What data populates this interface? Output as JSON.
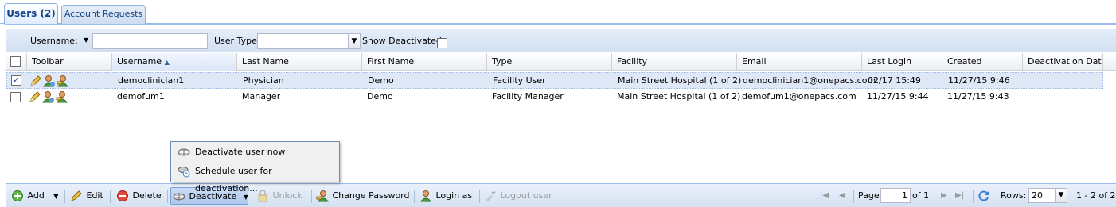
{
  "tabs": [
    {
      "label": "Users (2)"
    },
    {
      "label": "Account Requests"
    }
  ],
  "filter": {
    "username_label": "Username:",
    "username_value": "",
    "usertype_label": "User Type:",
    "usertype_value": "",
    "show_deactivated_label": "Show Deactivated:",
    "show_deactivated": false
  },
  "columns": [
    "Toolbar",
    "Username",
    "Last Name",
    "First Name",
    "Type",
    "Facility",
    "Email",
    "Last Login",
    "Created",
    "Deactivation Date"
  ],
  "sort": {
    "column": "Username",
    "direction": "ascending"
  },
  "rows": [
    {
      "selected": true,
      "username": "democlinician1",
      "last_name": "Physician",
      "first_name": "Demo",
      "type": "Facility User",
      "facility": "Main Street Hospital (1 of 2)",
      "email": "democlinician1@onepacs.com",
      "last_login": "02/17 15:49",
      "created": "11/27/15 9:46",
      "deactivation_date": ""
    },
    {
      "selected": false,
      "username": "demofum1",
      "last_name": "Manager",
      "first_name": "Demo",
      "type": "Facility Manager",
      "facility": "Main Street Hospital (1 of 2)",
      "email": "demofum1@onepacs.com",
      "last_login": "11/27/15 9:44",
      "created": "11/27/15 9:43",
      "deactivation_date": ""
    }
  ],
  "row_icons": [
    "pencil-icon",
    "user-icon",
    "key-user-icon"
  ],
  "menu": {
    "items": [
      {
        "label": "Deactivate user now",
        "icon": "deactivate-icon"
      },
      {
        "label": "Schedule user for deactivation...",
        "icon": "schedule-deactivate-icon"
      }
    ]
  },
  "toolbar": {
    "add": "Add",
    "edit": "Edit",
    "delete": "Delete",
    "deactivate": "Deactivate",
    "unlock": "Unlock",
    "change_password": "Change Password",
    "login_as": "Login as",
    "logout_user": "Logout user"
  },
  "paging": {
    "page_label": "Page",
    "page_value": "1",
    "of_label": "of 1",
    "rows_label": "Rows:",
    "rows_value": "20",
    "summary": "1 - 2 of 2"
  },
  "colors": {
    "accent": "#15428b",
    "border": "#99bbe8",
    "selected_row": "#dfe8f6"
  }
}
